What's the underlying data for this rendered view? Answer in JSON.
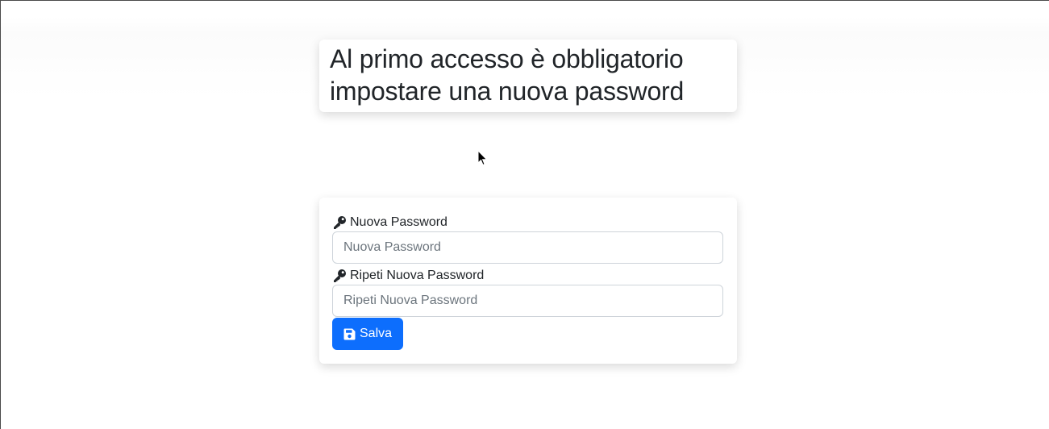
{
  "page": {
    "title_line1": "Al primo accesso è obbligatorio",
    "title_line2": "impostare una nuova password"
  },
  "form": {
    "new_password": {
      "label": "Nuova Password",
      "placeholder": "Nuova Password",
      "icon": "key-icon"
    },
    "repeat_password": {
      "label": "Ripeti Nuova Password",
      "placeholder": "Ripeti Nuova Password",
      "icon": "key-icon"
    },
    "save_button": {
      "label": "Salva",
      "icon": "floppy-disk-icon"
    }
  },
  "colors": {
    "primary": "#0d6efd",
    "text": "#212529",
    "placeholder": "#6c757d",
    "input_border": "#ced4da"
  }
}
